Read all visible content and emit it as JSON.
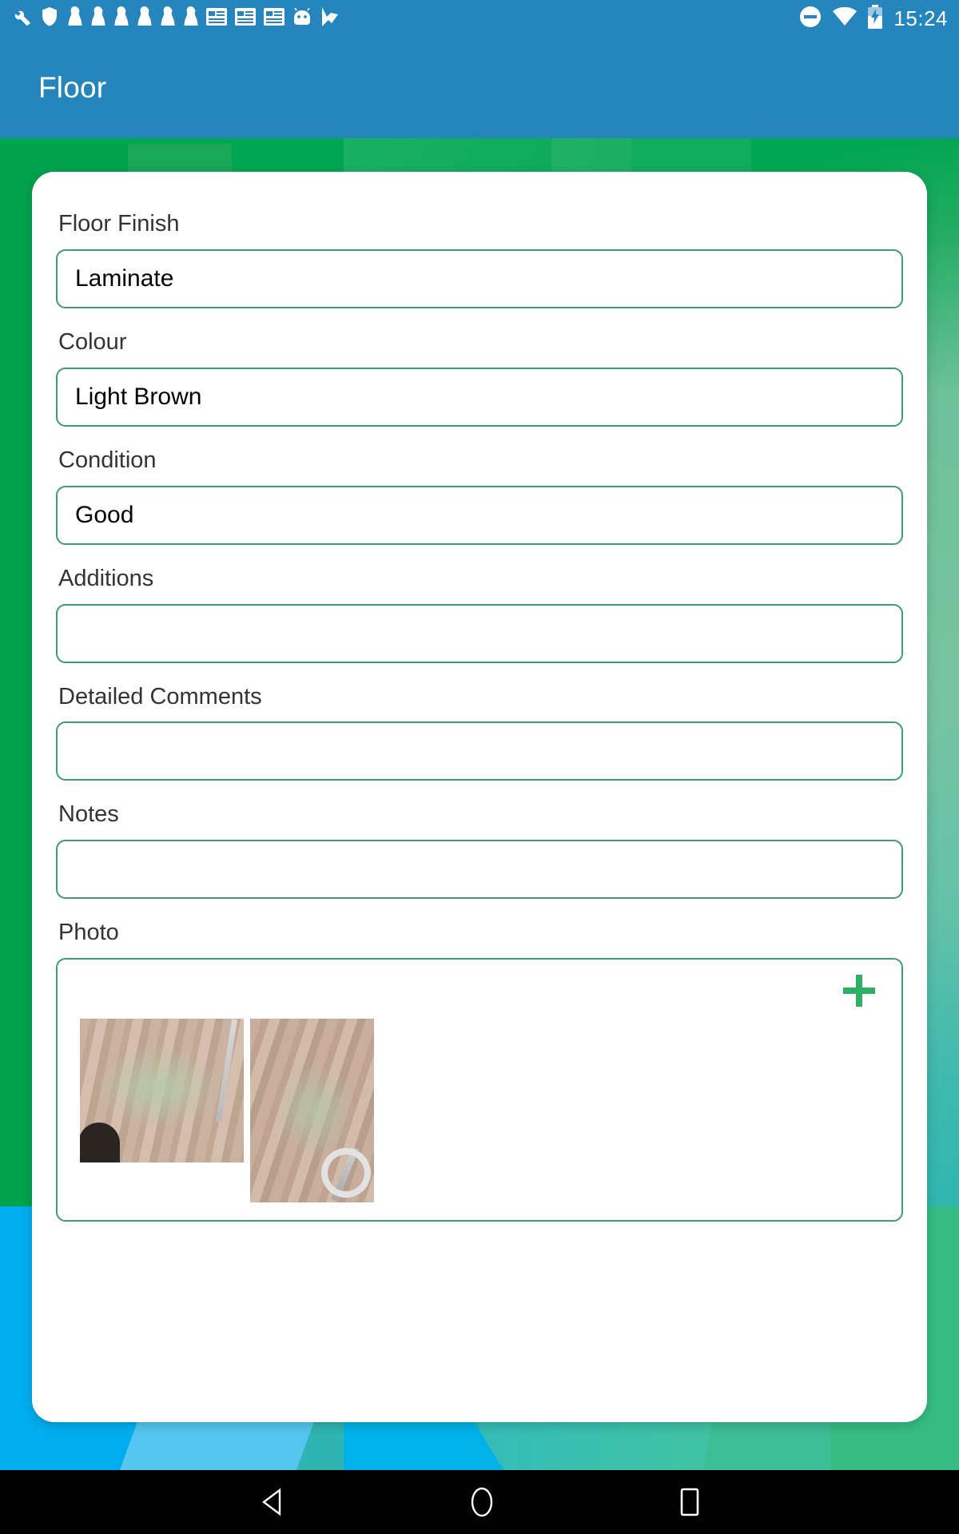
{
  "statusbar": {
    "time": "15:24",
    "left_icons": [
      "wrench-icon",
      "shield-icon",
      "keyhole-icon",
      "keyhole-icon",
      "keyhole-icon",
      "keyhole-icon",
      "keyhole-icon",
      "keyhole-icon",
      "list-card-icon",
      "list-card-icon",
      "list-card-icon",
      "android-robot-icon",
      "check-flag-icon"
    ],
    "right_icons": [
      "do-not-disturb-icon",
      "wifi-icon",
      "battery-charging-icon"
    ]
  },
  "appbar": {
    "title": "Floor"
  },
  "form": {
    "fields": [
      {
        "label": "Floor Finish",
        "value": "Laminate",
        "empty": false
      },
      {
        "label": "Colour",
        "value": "Light Brown",
        "empty": false
      },
      {
        "label": "Condition",
        "value": "Good",
        "empty": false
      },
      {
        "label": "Additions",
        "value": "",
        "empty": true
      },
      {
        "label": "Detailed Comments",
        "value": "",
        "empty": true
      },
      {
        "label": "Notes",
        "value": "",
        "empty": true
      }
    ],
    "photo": {
      "label": "Photo",
      "add_button": "+",
      "thumbnails": [
        {
          "name": "laminate-floor-photo-1"
        },
        {
          "name": "laminate-floor-photo-2"
        }
      ]
    }
  },
  "navbar": {
    "back": "back-triangle-icon",
    "home": "home-circle-icon",
    "recents": "recents-square-icon"
  },
  "colors": {
    "appbar_blue": "#2585bd",
    "field_border_green": "#3c9d73",
    "accent_green": "#2eb062",
    "wallpaper_green": "#00a651",
    "card_white": "#ffffff"
  }
}
